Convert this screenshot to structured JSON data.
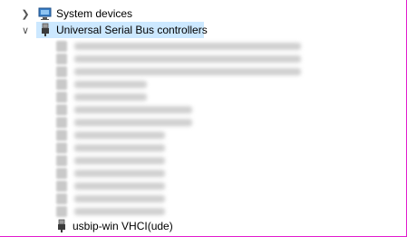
{
  "tree": {
    "system_devices": {
      "label": "System devices",
      "expanded": false,
      "icon": "system-devices-icon"
    },
    "usb_controllers": {
      "label": "Universal Serial Bus controllers",
      "expanded": true,
      "selected": true,
      "icon": "usb-plug-icon",
      "blurred_children_count": 14,
      "visible_child": {
        "label": "usbip-win VHCI(ude)",
        "icon": "usb-plug-icon"
      }
    }
  },
  "colors": {
    "selection": "#cce8ff",
    "border_accent": "#e21bcd"
  }
}
